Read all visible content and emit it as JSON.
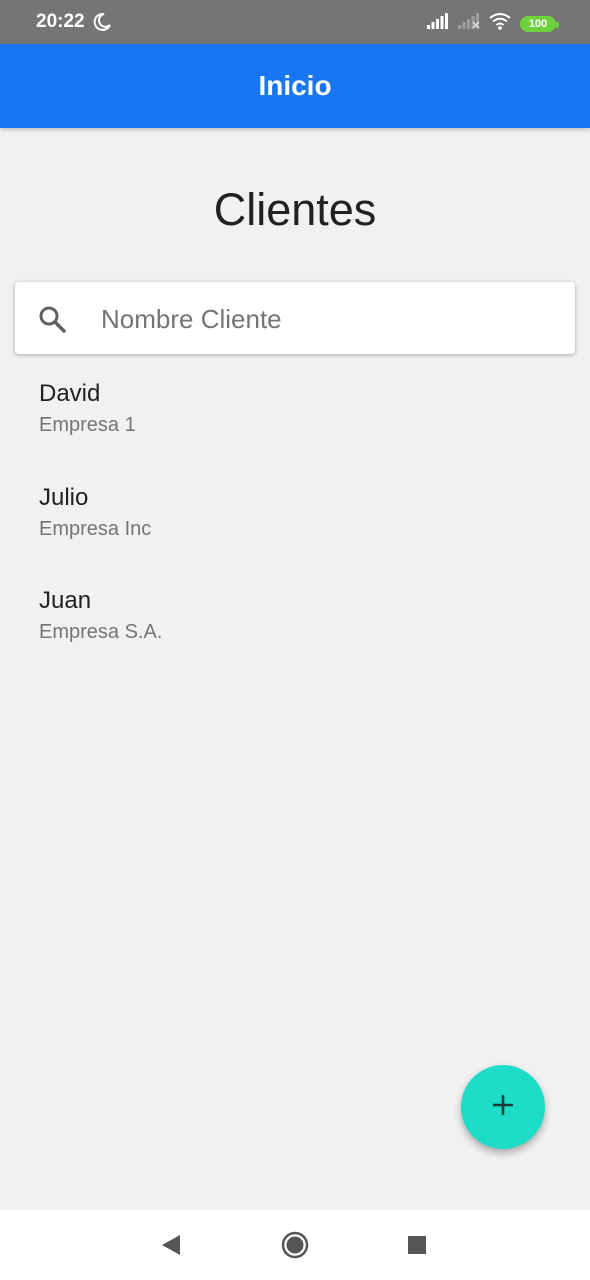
{
  "status_bar": {
    "time": "20:22",
    "battery": "100",
    "icons": [
      "moon-icon",
      "signal-icon",
      "signal-off-icon",
      "wifi-icon",
      "battery-icon"
    ]
  },
  "app_bar": {
    "title": "Inicio",
    "color": "#1976f2"
  },
  "page": {
    "title": "Clientes"
  },
  "search": {
    "placeholder": "Nombre Cliente",
    "value": "",
    "icon": "search-icon"
  },
  "clients": [
    {
      "name": "David",
      "company": "Empresa 1"
    },
    {
      "name": "Julio",
      "company": "Empresa Inc"
    },
    {
      "name": "Juan",
      "company": "Empresa S.A."
    }
  ],
  "fab": {
    "icon": "plus-icon",
    "color": "#1ddcc8"
  },
  "nav_bar": {
    "icons": [
      "back-icon",
      "home-icon",
      "recents-icon"
    ]
  }
}
